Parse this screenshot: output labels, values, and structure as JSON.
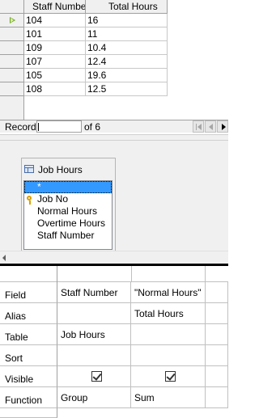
{
  "result_grid": {
    "columns": [
      "Staff Number",
      "Total Hours"
    ],
    "rows": [
      [
        "104",
        "16"
      ],
      [
        "101",
        "11"
      ],
      [
        "109",
        "10.4"
      ],
      [
        "107",
        "12.4"
      ],
      [
        "105",
        "19.6"
      ],
      [
        "108",
        "12.5"
      ]
    ],
    "current_row_icon": "play-arrow-icon"
  },
  "record_nav": {
    "label": "Record",
    "current": "",
    "of_text": "of 6"
  },
  "table_window": {
    "title": "Job Hours",
    "icon": "table-icon",
    "fields": [
      "*",
      "Job No",
      "Normal Hours",
      "Overtime Hours",
      "Staff Number"
    ],
    "selected_field": "*",
    "key_field": "Job No"
  },
  "design_grid": {
    "row_labels": [
      "Field",
      "Alias",
      "Table",
      "Sort",
      "Visible",
      "Function"
    ],
    "columns": [
      {
        "field": "Staff Number",
        "alias": "",
        "table": "Job Hours",
        "sort": "",
        "visible": true,
        "function": "Group"
      },
      {
        "field": "\"Normal Hours\"",
        "alias": "Total Hours",
        "table": "",
        "sort": "",
        "visible": true,
        "function": "Sum"
      }
    ]
  }
}
